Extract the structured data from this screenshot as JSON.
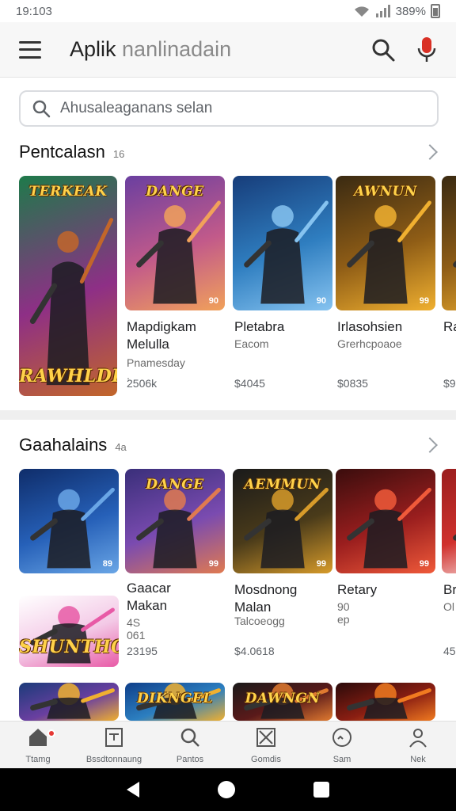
{
  "status_bar": {
    "time": "19:103",
    "battery": "389%"
  },
  "app_bar": {
    "title_main": "Aplik",
    "title_sub": " nanlinadain"
  },
  "search": {
    "placeholder": "Ahusaleaganans selan"
  },
  "sections": [
    {
      "title": "Pentcalasn",
      "count": "16",
      "items": [
        {
          "thumb_title": "TERKEAK",
          "thumb_caption": "RAWHLDE",
          "name": "",
          "sub": "",
          "sub2": "",
          "price": "",
          "badge": "",
          "colors": [
            "#1e7a4a",
            "#8e2f86",
            "#c2662a"
          ]
        },
        {
          "thumb_title": "DANGE",
          "name": "Mapdigkam\nMelulla",
          "sub": "Pnamesday .",
          "price": "2506k",
          "badge": "90",
          "colors": [
            "#6a3fa0",
            "#c25a8a",
            "#f1a15a"
          ]
        },
        {
          "thumb_title": "",
          "name": "Pletabra",
          "sub": "Eacom",
          "price": "$4045",
          "badge": "90",
          "colors": [
            "#173d7a",
            "#2f7ec0",
            "#86c3f0"
          ]
        },
        {
          "thumb_title": "AWNUN",
          "name": "Irlasohsien",
          "sub": "Grerhcpoaoe",
          "price": "$0835",
          "badge": "99",
          "colors": [
            "#3a2a12",
            "#8f5d16",
            "#f0b030"
          ]
        },
        {
          "thumb_title": "",
          "name": "Ra",
          "sub": "",
          "price": "$9",
          "badge": "",
          "colors": [
            "#3a2a12",
            "#8f5d16",
            "#f0b030"
          ]
        }
      ]
    },
    {
      "title": "Gaahalains",
      "count": "4a",
      "items": [
        {
          "thumb_title": "",
          "name": "Gaacar\nMakan",
          "sub": "4S 061",
          "price": "23195",
          "badge": "89",
          "colors": [
            "#0f2d6a",
            "#2660b8",
            "#6aa6e6"
          ],
          "extra_caption": "SHUNTHOX"
        },
        {
          "thumb_title": "DANGE",
          "name": "",
          "sub": "",
          "price": "",
          "badge": "99",
          "colors": [
            "#3a2f7a",
            "#7a4bb0",
            "#e07a50"
          ]
        },
        {
          "thumb_title": "AEMMUN",
          "name": "Mosdnong\nMalan",
          "sub": "Talcoeogg",
          "price": "$4.0618",
          "badge": "99",
          "colors": [
            "#1a1a1a",
            "#4a3b1a",
            "#d79b2a"
          ]
        },
        {
          "thumb_title": "",
          "name": "Retary",
          "sub": "90 ep",
          "price": "",
          "badge": "99",
          "colors": [
            "#3a0d0d",
            "#9a1e1e",
            "#f05a3a"
          ]
        },
        {
          "thumb_title": "",
          "name": "Br",
          "sub": "Ol",
          "price": "45",
          "badge": "",
          "colors": [
            "#9a1e1e",
            "#d0312d",
            "#ffffff"
          ]
        }
      ]
    }
  ],
  "third_row": [
    {
      "thumb_title": "",
      "colors": [
        "#1b3b7a",
        "#6a3fa0",
        "#f0b030"
      ]
    },
    {
      "thumb_title": "DIKNGEL",
      "colors": [
        "#0f3f8a",
        "#2c7fc0",
        "#f0b030"
      ]
    },
    {
      "thumb_title": "DAWNGN",
      "colors": [
        "#1a1a1a",
        "#5a1a1a",
        "#e07a30"
      ]
    },
    {
      "thumb_title": "",
      "colors": [
        "#2a0a0a",
        "#8a1e12",
        "#f07a20"
      ]
    }
  ],
  "bottom_nav": [
    {
      "label": "Ttamg",
      "icon": "home-icon"
    },
    {
      "label": "Bssdtonnaung",
      "icon": "library-icon"
    },
    {
      "label": "Pantos",
      "icon": "search-icon"
    },
    {
      "label": "Gomdis",
      "icon": "games-icon"
    },
    {
      "label": "Sam",
      "icon": "face-icon"
    },
    {
      "label": "Nek",
      "icon": "person-icon"
    }
  ]
}
